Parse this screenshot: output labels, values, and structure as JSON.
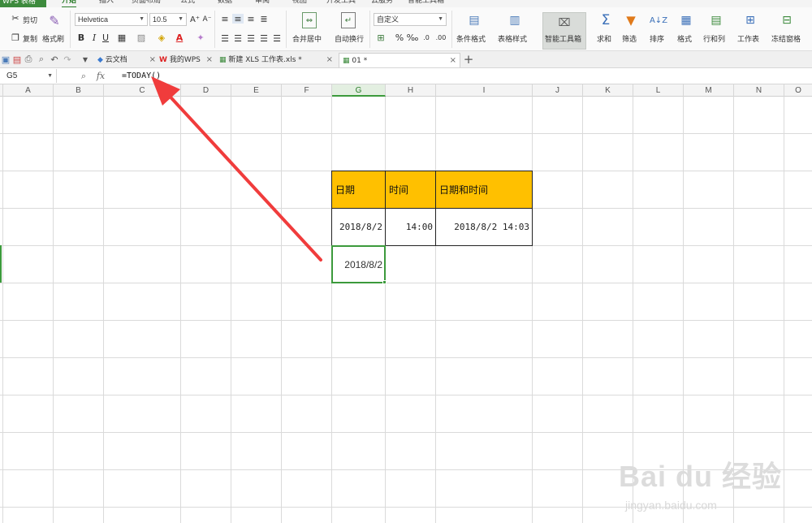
{
  "menubar": {
    "app_label": "WPS 表格",
    "tabs": [
      "开始",
      "插入",
      "页面布局",
      "公式",
      "数据",
      "审阅",
      "视图",
      "开发工具",
      "云服务",
      "智能工具箱"
    ]
  },
  "ribbon": {
    "cut_label": "剪切",
    "copy_label": "复制",
    "format_painter_label": "格式刷",
    "font_family": "Helvetica",
    "font_size": "10.5",
    "merge_center_label": "合并居中",
    "wrap_text_label": "自动换行",
    "number_format": "自定义",
    "conditional_format_label": "条件格式",
    "table_style_label": "表格样式",
    "smart_toolbox_label": "智能工具箱",
    "sum_label": "求和",
    "filter_label": "筛选",
    "sort_label": "排序",
    "format_label": "格式",
    "rows_cols_label": "行和列",
    "worksheet_label": "工作表",
    "freeze_label": "冻结窗格",
    "bold": "B",
    "italic": "I",
    "underline": "U",
    "percent": "%",
    "thousands": "‰"
  },
  "tabbar": {
    "tabs": [
      {
        "label": "云文档",
        "active": false
      },
      {
        "label": "我的WPS",
        "active": false
      },
      {
        "label": "新建 XLS 工作表.xls *",
        "active": false
      },
      {
        "label": "01 *",
        "active": true
      }
    ],
    "add_label": "+"
  },
  "formula_bar": {
    "cell_ref": "G5",
    "fx_label": "fx",
    "formula": "=TODAY()"
  },
  "columns": [
    "A",
    "B",
    "C",
    "D",
    "E",
    "F",
    "G",
    "H",
    "I",
    "J",
    "K",
    "L",
    "M",
    "N",
    "O"
  ],
  "selected_column": "G",
  "table": {
    "headers": [
      "日期",
      "时间",
      "日期和时间"
    ],
    "values": [
      "2018/8/2",
      "14:00",
      "2018/8/2 14:03"
    ]
  },
  "active_cell": {
    "ref": "G5",
    "value": "2018/8/2"
  },
  "watermark": {
    "brand": "Bai du 经验",
    "url": "jingyan.baidu.com"
  },
  "colors": {
    "accent": "#3c9a3c",
    "header_fill": "#ffc000",
    "arrow": "#f03c3c"
  }
}
